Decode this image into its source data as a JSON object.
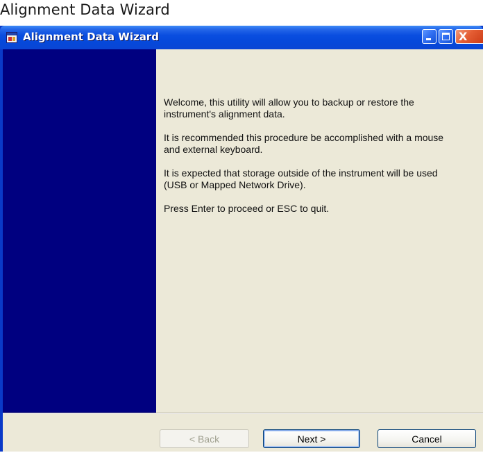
{
  "page": {
    "caption": "Alignment Data Wizard"
  },
  "window": {
    "title": "Alignment Data Wizard",
    "icons": {
      "app": "app-icon",
      "minimize": "minimize-icon",
      "maximize": "maximize-icon",
      "close": "close-icon"
    },
    "close_glyph": "X"
  },
  "wizard": {
    "paragraphs": [
      "Welcome, this utility will allow you to backup or restore the\ninstrument's alignment data.",
      "It is recommended this procedure be accomplished with a mouse\nand external keyboard.",
      "It is expected that storage outside of the instrument will be used\n(USB or Mapped Network Drive).",
      "Press Enter to proceed or ESC to quit."
    ],
    "side_panel_color": "#000080"
  },
  "buttons": {
    "back": "< Back",
    "next": "Next >",
    "cancel": "Cancel"
  },
  "colors": {
    "titlebar": "#0a4ee0",
    "client_bg": "#ece9d8",
    "close_button": "#e45d33"
  }
}
